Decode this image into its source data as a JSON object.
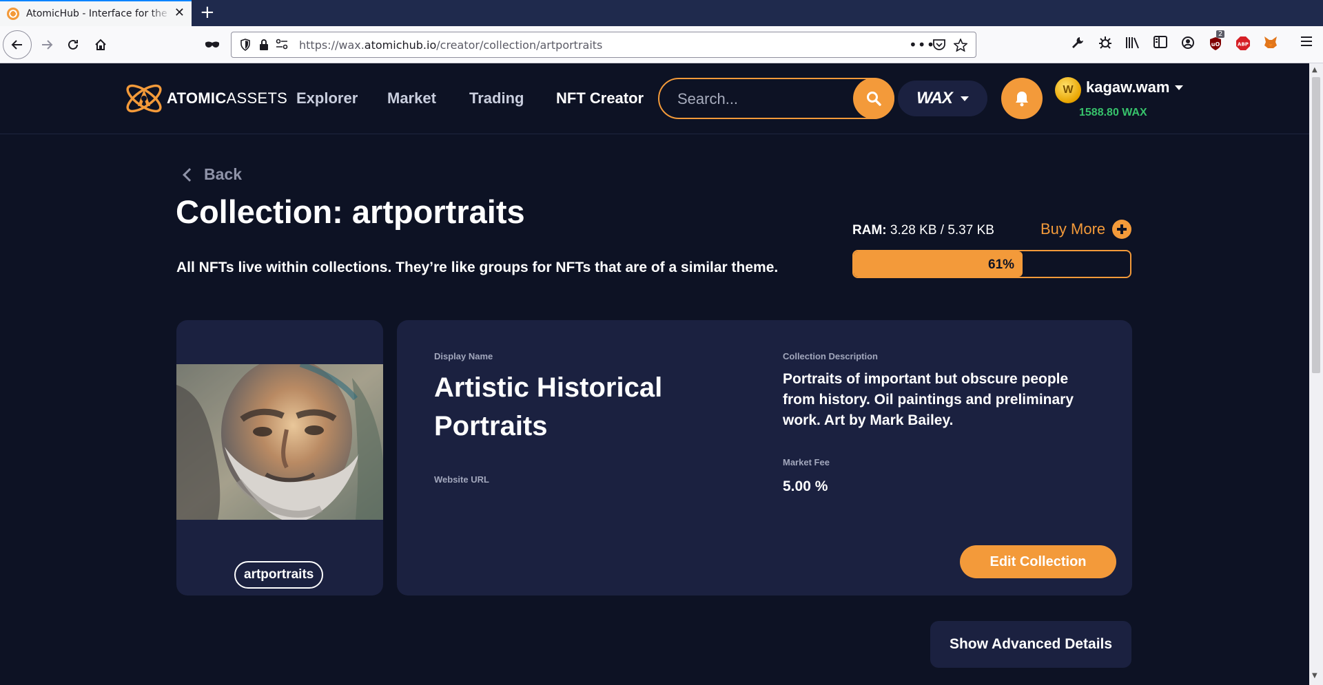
{
  "browser": {
    "tab_title": "AtomicHub - Interface for the E",
    "url_prefix": "https://wax.",
    "url_host": "atomichub.io",
    "url_path": "/creator/collection/artportraits",
    "ublock_badge": "2"
  },
  "header": {
    "logo_bold": "ATOMIC",
    "logo_light": "ASSETS",
    "nav": {
      "explorer": "Explorer",
      "market": "Market",
      "trading": "Trading",
      "nft_creator": "NFT Creator"
    },
    "search_placeholder": "Search...",
    "chain": "WAX",
    "username": "kagaw.wam",
    "balance": "1588.80 WAX",
    "avatar_letter": "W"
  },
  "page": {
    "back_label": "Back",
    "title": "Collection: artportraits",
    "subtitle": "All NFTs live within collections. They’re like groups for NFTs that are of a similar theme.",
    "ram_label": "RAM:",
    "ram_value": "3.28 KB / 5.37 KB",
    "buy_more": "Buy More",
    "ram_percent_text": "61%",
    "ram_fraction": 0.61
  },
  "collection": {
    "tag": "artportraits",
    "display_name_label": "Display Name",
    "display_name": "Artistic Historical Portraits",
    "website_label": "Website URL",
    "description_label": "Collection Description",
    "description": "Portraits of important but obscure people from history. Oil paintings and preliminary work. Art by Mark Bailey.",
    "fee_label": "Market Fee",
    "fee": "5.00 %",
    "edit_button": "Edit Collection"
  },
  "advanced_button": "Show Advanced Details",
  "colors": {
    "accent": "#f39a3a",
    "background": "#0d1224",
    "card": "#1b2140",
    "balance": "#37c26b"
  }
}
